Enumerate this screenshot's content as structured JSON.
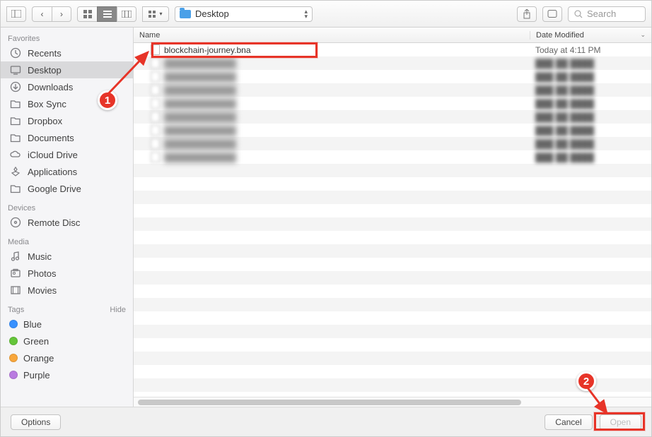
{
  "toolbar": {
    "path_label": "Desktop",
    "search_placeholder": "Search"
  },
  "sidebar": {
    "sections": [
      {
        "title": "Favorites",
        "items": [
          {
            "label": "Recents",
            "icon": "clock-icon"
          },
          {
            "label": "Desktop",
            "icon": "desktop-icon",
            "selected": true
          },
          {
            "label": "Downloads",
            "icon": "downloads-icon"
          },
          {
            "label": "Box Sync",
            "icon": "folder-icon"
          },
          {
            "label": "Dropbox",
            "icon": "folder-icon"
          },
          {
            "label": "Documents",
            "icon": "folder-icon"
          },
          {
            "label": "iCloud Drive",
            "icon": "cloud-icon"
          },
          {
            "label": "Applications",
            "icon": "applications-icon"
          },
          {
            "label": "Google Drive",
            "icon": "folder-icon"
          }
        ]
      },
      {
        "title": "Devices",
        "items": [
          {
            "label": "Remote Disc",
            "icon": "disc-icon"
          }
        ]
      },
      {
        "title": "Media",
        "items": [
          {
            "label": "Music",
            "icon": "music-icon"
          },
          {
            "label": "Photos",
            "icon": "photos-icon"
          },
          {
            "label": "Movies",
            "icon": "movies-icon"
          }
        ]
      },
      {
        "title": "Tags",
        "hide_label": "Hide",
        "items": [
          {
            "label": "Blue",
            "tag_class": "tag-blue"
          },
          {
            "label": "Green",
            "tag_class": "tag-green"
          },
          {
            "label": "Orange",
            "tag_class": "tag-orange"
          },
          {
            "label": "Purple",
            "tag_class": "tag-purple"
          }
        ]
      }
    ]
  },
  "columns": {
    "name": "Name",
    "date": "Date Modified"
  },
  "files": [
    {
      "name": "blockchain-journey.bna",
      "date": "Today at 4:11 PM",
      "visible": true
    }
  ],
  "blurred_rows": 8,
  "footer": {
    "options": "Options",
    "cancel": "Cancel",
    "open": "Open"
  },
  "annotations": {
    "badge1": "1",
    "badge2": "2"
  }
}
